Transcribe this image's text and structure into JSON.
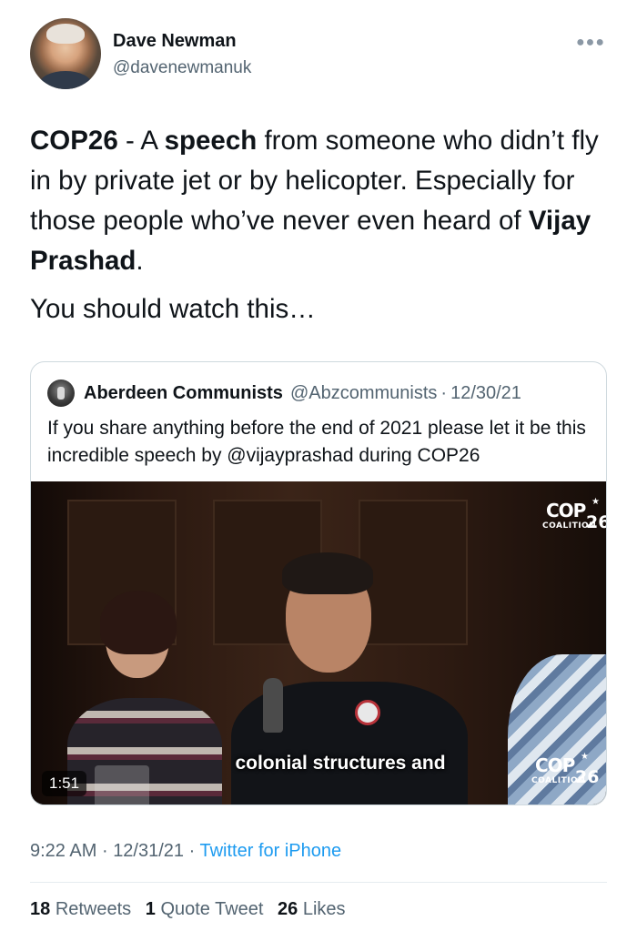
{
  "author": {
    "name": "Dave Newman",
    "handle": "@davenewmanuk",
    "more_icon": "more-icon"
  },
  "tweet": {
    "line_parts": {
      "p1_bold": "COP26",
      "p2": " - A ",
      "p3_bold": "speech",
      "p4": " from someone who didn’t fly in by private jet or by helicopter. Especially for those people who’ve never even heard of ",
      "p5_bold": "Vijay Prashad",
      "p6": "."
    },
    "second_paragraph": "You should watch this…"
  },
  "quote": {
    "name": "Aberdeen Communists",
    "handle": "@Abzcommunists",
    "separator": "·",
    "date": "12/30/21",
    "text": "If you share anything before the end of 2021 please let it be this incredible speech by @vijayprashad during COP26",
    "video": {
      "subtitle": "colonial structures and",
      "duration": "1:51",
      "logo": {
        "cop": "COP",
        "number": "26",
        "coalition": "COALITION"
      }
    }
  },
  "meta": {
    "time": "9:22 AM",
    "separator": "·",
    "date": "12/31/21",
    "source": "Twitter for iPhone"
  },
  "stats": {
    "retweets_count": "18",
    "retweets_label": "Retweets",
    "quotes_count": "1",
    "quotes_label": "Quote Tweet",
    "likes_count": "26",
    "likes_label": "Likes"
  },
  "colors": {
    "link": "#1d9bf0",
    "secondary_text": "#536471",
    "primary_text": "#0f1419"
  }
}
